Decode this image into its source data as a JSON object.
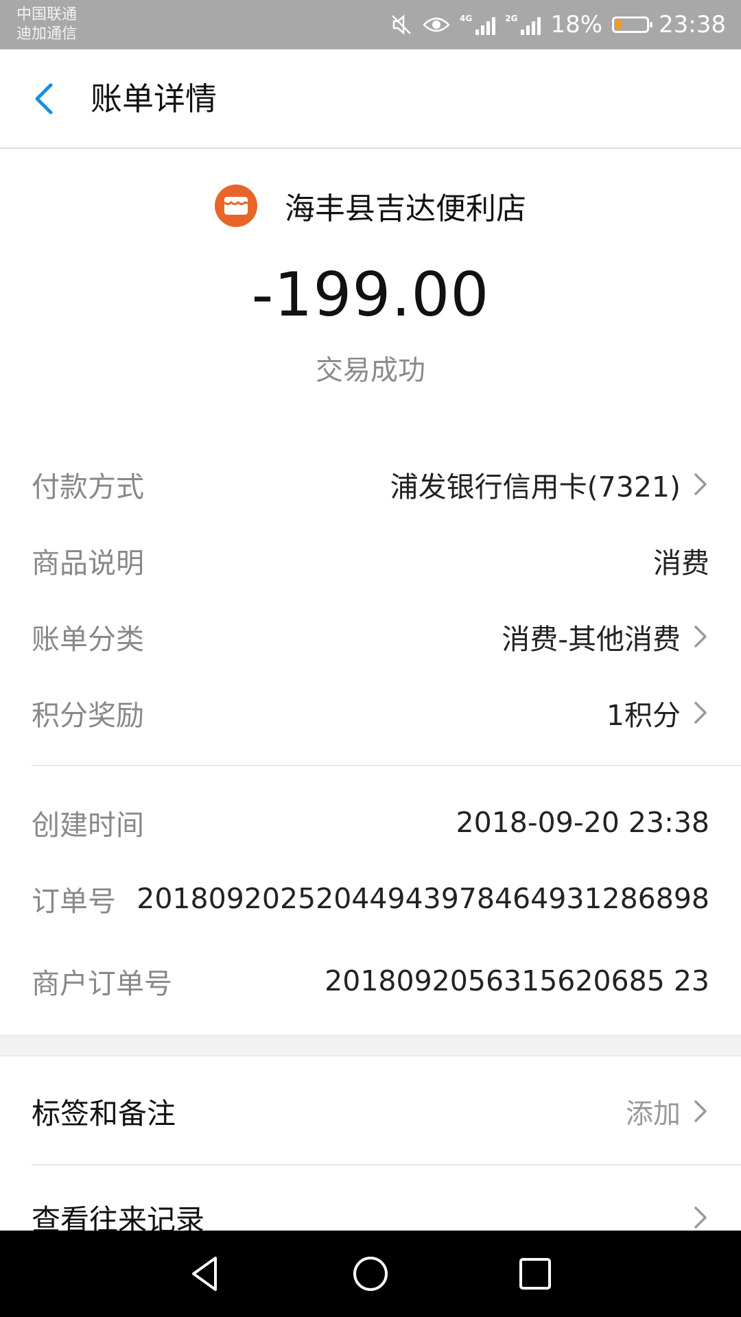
{
  "status_bar": {
    "carrier_line1": "中国联通",
    "carrier_line2": "迪加通信",
    "network1": "4G",
    "network2": "2G",
    "battery_percent": "18%",
    "battery_level": 0.18,
    "time": "23:38"
  },
  "header": {
    "title": "账单详情"
  },
  "merchant": {
    "name": "海丰县吉达便利店",
    "amount": "-199.00",
    "status": "交易成功"
  },
  "details": [
    {
      "label": "付款方式",
      "value": "浦发银行信用卡(7321)",
      "has_chevron": true
    },
    {
      "label": "商品说明",
      "value": "消费",
      "has_chevron": false
    },
    {
      "label": "账单分类",
      "value": "消费-其他消费",
      "has_chevron": true
    },
    {
      "label": "积分奖励",
      "value": "1积分",
      "has_chevron": true
    }
  ],
  "order_info": [
    {
      "label": "创建时间",
      "value": "2018-09-20 23:38"
    },
    {
      "label": "订单号",
      "value": "20180920252044943978464931286898"
    },
    {
      "label": "商户订单号",
      "value": "2018092056315620685 23"
    }
  ],
  "actions": [
    {
      "label": "标签和备注",
      "value": "添加"
    },
    {
      "label": "查看往来记录",
      "value": ""
    }
  ],
  "colors": {
    "accent_blue": "#1a8fe0",
    "merchant_orange": "#e8652a",
    "battery_orange": "#f59a23",
    "status_bar_gray": "#a8a8a8"
  },
  "icons": {
    "back": "chevron-left-icon",
    "merchant": "shop-icon",
    "row_chevron": "chevron-right-icon",
    "nav_back": "triangle-back-icon",
    "nav_home": "circle-home-icon",
    "nav_recents": "square-recents-icon"
  }
}
